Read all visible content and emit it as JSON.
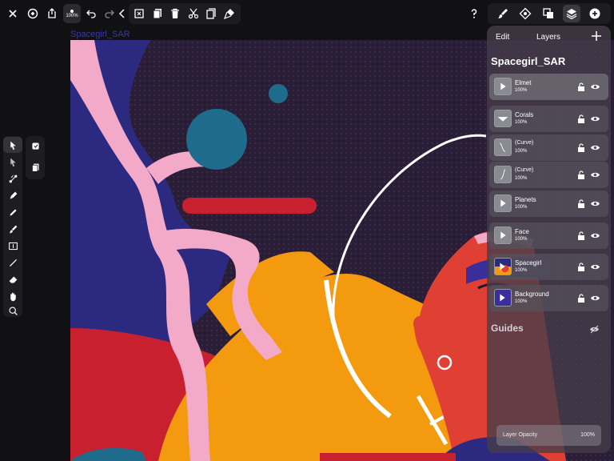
{
  "document": {
    "name": "Spacegirl_SAR"
  },
  "toolbar": {
    "zoom_label": "100%"
  },
  "panel": {
    "edit_label": "Edit",
    "title": "Layers",
    "doc_name": "Spacegirl_SAR",
    "layers": [
      {
        "name": "Elmet",
        "opacity": "100%",
        "selected": true
      },
      {
        "name": "Corals",
        "opacity": "100%"
      },
      {
        "name": "(Curve)",
        "opacity": "100%"
      },
      {
        "name": "(Curve)",
        "opacity": "100%"
      },
      {
        "name": "Planets",
        "opacity": "100%"
      },
      {
        "name": "Face",
        "opacity": "100%"
      },
      {
        "name": "Spacegirl",
        "opacity": "100%"
      },
      {
        "name": "Background",
        "opacity": "100%"
      }
    ],
    "guides_label": "Guides",
    "layer_opacity_label": "Layer Opacity",
    "layer_opacity_value": "100%"
  },
  "colors": {
    "accent_red": "#c8202e",
    "navy": "#2b2a80",
    "pink": "#f3a9c8",
    "orange": "#f49a0e",
    "teal": "#1f6b8c",
    "space": "#2a1d36"
  }
}
